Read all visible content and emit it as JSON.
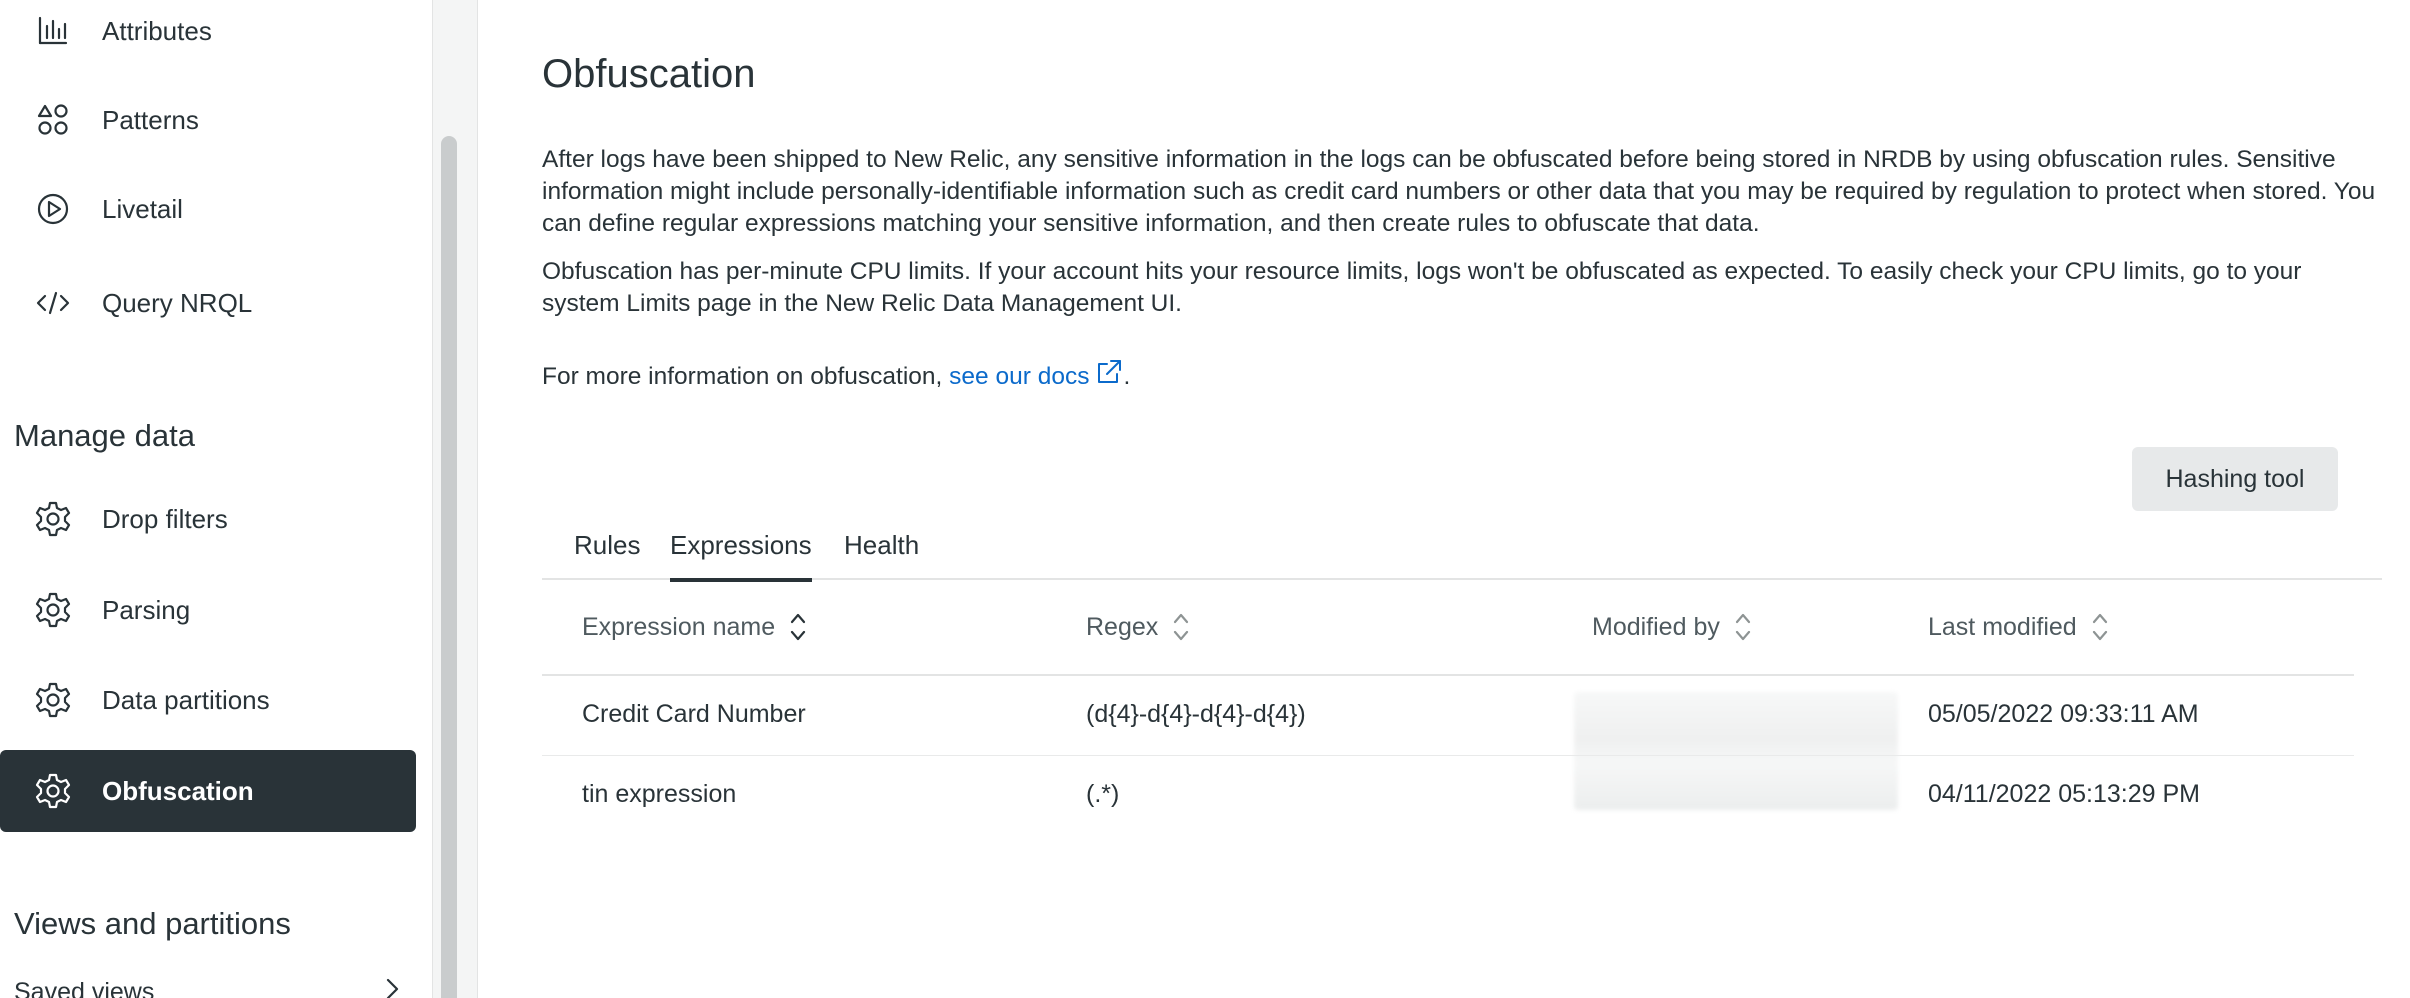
{
  "sidebar": {
    "top_items": [
      {
        "label": "Attributes",
        "icon": "bar-chart-icon"
      },
      {
        "label": "Patterns",
        "icon": "shapes-icon"
      },
      {
        "label": "Livetail",
        "icon": "play-circle-icon"
      },
      {
        "label": "Query NRQL",
        "icon": "code-icon"
      }
    ],
    "manage_data_title": "Manage data",
    "manage_items": [
      {
        "label": "Drop filters",
        "icon": "gear-icon"
      },
      {
        "label": "Parsing",
        "icon": "gear-icon"
      },
      {
        "label": "Data partitions",
        "icon": "gear-icon"
      },
      {
        "label": "Obfuscation",
        "icon": "gear-icon",
        "active": true
      }
    ],
    "views_title": "Views and partitions",
    "saved_views": "Saved views"
  },
  "main": {
    "title": "Obfuscation",
    "para1": "After logs have been shipped to New Relic, any sensitive information in the logs can be obfuscated before being stored in NRDB by using obfuscation rules. Sensitive information might include personally-identifiable information such as credit card numbers or other data that you may be required by regulation to protect when stored. You can define regular expressions matching your sensitive information, and then create rules to obfuscate that data.",
    "para2": "Obfuscation has per-minute CPU limits. If your account hits your resource limits, logs won't be obfuscated as expected. To easily check your CPU limits, go to your system Limits page in the New Relic Data Management UI.",
    "para3_prefix": "For more information on obfuscation, ",
    "para3_link": "see our docs",
    "para3_suffix": ".",
    "hashing_tool": "Hashing tool",
    "tabs": [
      "Rules",
      "Expressions",
      "Health"
    ],
    "active_tab": "Expressions",
    "table": {
      "columns": [
        "Expression name",
        "Regex",
        "Modified by",
        "Last modified"
      ],
      "rows": [
        {
          "name": "Credit Card Number",
          "regex": "(d{4}-d{4}-d{4}-d{4})",
          "modified_by": "",
          "last_modified": "05/05/2022 09:33:11 AM"
        },
        {
          "name": "tin expression",
          "regex": "(.*)",
          "modified_by": "",
          "last_modified": "04/11/2022 05:13:29 PM"
        }
      ]
    }
  },
  "colors": {
    "text": "#293338",
    "active_nav_bg": "#293338",
    "link": "#0b6acb",
    "button_bg": "#e7e9ea"
  }
}
